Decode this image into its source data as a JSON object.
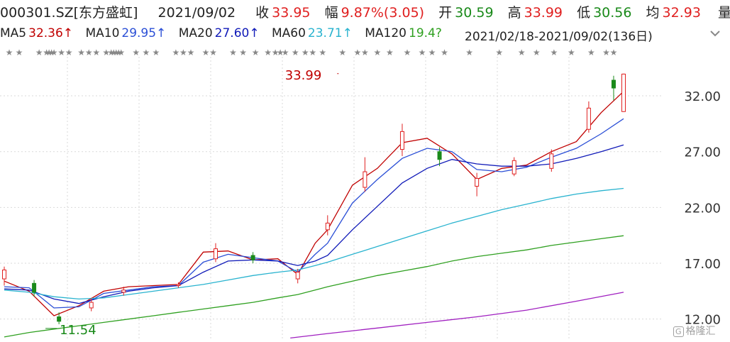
{
  "header": {
    "code": "000301.SZ[东方盛虹]",
    "date": "2021/09/02",
    "close_label": "收",
    "close": "33.95",
    "change_label": "幅",
    "change": "9.87%(3.05)",
    "open_label": "开",
    "open": "30.59",
    "high_label": "高",
    "high": "33.99",
    "low_label": "低",
    "low": "30.56",
    "avg_label": "均",
    "avg": "32.93",
    "volume_label": "量"
  },
  "ma_legend": [
    {
      "label": "MA5",
      "value": "32.36↑",
      "color": "#c00000"
    },
    {
      "label": "MA10",
      "value": "29.95↑",
      "color": "#2b4fd6"
    },
    {
      "label": "MA20",
      "value": "27.60↑",
      "color": "#101ab8"
    },
    {
      "label": "MA60",
      "value": "23.71↑",
      "color": "#29b3cf"
    },
    {
      "label": "MA120",
      "value": "19.4?",
      "color": "#2fa020"
    }
  ],
  "range_label": "2021/02/18-2021/09/02(136日)",
  "watermark": "格隆汇",
  "colors": {
    "up": "#e02020",
    "down": "#1a8a1a",
    "grid": "#d9d9d9",
    "axis_text": "#333333"
  },
  "chart_data": {
    "type": "candlestick",
    "title": "000301.SZ[东方盛虹]",
    "x_range": [
      "2021/02/18",
      "2021/09/02"
    ],
    "num_days": 136,
    "y_ticks": [
      12.0,
      17.0,
      22.0,
      27.0,
      32.0
    ],
    "ylim": [
      10.2,
      35.5
    ],
    "grid": true,
    "annotations": [
      {
        "text": "33.99",
        "type": "high",
        "day": 135,
        "price": 33.99
      },
      {
        "text": "11.54",
        "type": "low",
        "day": 20,
        "price": 11.54
      }
    ],
    "series": [
      {
        "name": "MA5",
        "color": "#c00000",
        "points": [
          [
            0,
            15.4
          ],
          [
            10,
            14.5
          ],
          [
            20,
            12.3
          ],
          [
            30,
            13.2
          ],
          [
            40,
            14.5
          ],
          [
            50,
            14.9
          ],
          [
            60,
            15.0
          ],
          [
            70,
            15.1
          ],
          [
            80,
            18.0
          ],
          [
            90,
            18.1
          ],
          [
            100,
            17.3
          ],
          [
            110,
            17.4
          ],
          [
            118,
            16.0
          ],
          [
            125,
            18.8
          ],
          [
            130,
            20.0
          ],
          [
            140,
            24.0
          ],
          [
            150,
            25.5
          ],
          [
            160,
            27.8
          ],
          [
            170,
            28.2
          ],
          [
            180,
            26.8
          ],
          [
            190,
            24.5
          ],
          [
            200,
            25.5
          ],
          [
            210,
            25.8
          ],
          [
            220,
            27.0
          ],
          [
            230,
            27.9
          ],
          [
            240,
            30.5
          ],
          [
            249,
            32.4
          ]
        ]
      },
      {
        "name": "MA10",
        "color": "#2b4fd6",
        "points": [
          [
            0,
            14.9
          ],
          [
            10,
            14.8
          ],
          [
            20,
            13.0
          ],
          [
            30,
            13.1
          ],
          [
            40,
            14.3
          ],
          [
            50,
            14.6
          ],
          [
            60,
            14.9
          ],
          [
            70,
            15.0
          ],
          [
            80,
            17.1
          ],
          [
            90,
            17.8
          ],
          [
            100,
            17.5
          ],
          [
            110,
            17.2
          ],
          [
            118,
            16.2
          ],
          [
            125,
            17.8
          ],
          [
            130,
            18.8
          ],
          [
            140,
            22.4
          ],
          [
            150,
            24.5
          ],
          [
            160,
            26.4
          ],
          [
            170,
            27.3
          ],
          [
            180,
            27.0
          ],
          [
            190,
            25.4
          ],
          [
            200,
            25.2
          ],
          [
            210,
            25.6
          ],
          [
            220,
            26.5
          ],
          [
            230,
            27.3
          ],
          [
            240,
            28.6
          ],
          [
            249,
            29.95
          ]
        ]
      },
      {
        "name": "MA20",
        "color": "#101ab8",
        "points": [
          [
            0,
            14.7
          ],
          [
            10,
            14.6
          ],
          [
            20,
            13.8
          ],
          [
            30,
            13.4
          ],
          [
            40,
            14.0
          ],
          [
            50,
            14.5
          ],
          [
            60,
            14.8
          ],
          [
            70,
            15.0
          ],
          [
            80,
            16.2
          ],
          [
            90,
            17.2
          ],
          [
            100,
            17.3
          ],
          [
            110,
            17.2
          ],
          [
            118,
            16.8
          ],
          [
            125,
            17.2
          ],
          [
            130,
            17.7
          ],
          [
            140,
            20.0
          ],
          [
            150,
            22.1
          ],
          [
            160,
            24.2
          ],
          [
            170,
            25.5
          ],
          [
            180,
            26.3
          ],
          [
            190,
            25.9
          ],
          [
            200,
            25.7
          ],
          [
            210,
            25.7
          ],
          [
            220,
            25.9
          ],
          [
            230,
            26.4
          ],
          [
            240,
            27.0
          ],
          [
            249,
            27.6
          ]
        ]
      },
      {
        "name": "MA60",
        "color": "#29b3cf",
        "points": [
          [
            0,
            14.6
          ],
          [
            10,
            14.4
          ],
          [
            20,
            14.0
          ],
          [
            30,
            13.8
          ],
          [
            40,
            13.9
          ],
          [
            50,
            14.2
          ],
          [
            60,
            14.5
          ],
          [
            70,
            14.8
          ],
          [
            80,
            15.1
          ],
          [
            90,
            15.5
          ],
          [
            100,
            15.9
          ],
          [
            110,
            16.2
          ],
          [
            118,
            16.4
          ],
          [
            125,
            16.8
          ],
          [
            130,
            17.1
          ],
          [
            140,
            17.8
          ],
          [
            150,
            18.5
          ],
          [
            160,
            19.2
          ],
          [
            170,
            19.9
          ],
          [
            180,
            20.6
          ],
          [
            190,
            21.2
          ],
          [
            200,
            21.8
          ],
          [
            210,
            22.3
          ],
          [
            220,
            22.8
          ],
          [
            230,
            23.2
          ],
          [
            240,
            23.5
          ],
          [
            249,
            23.71
          ]
        ]
      },
      {
        "name": "MA120",
        "color": "#2fa020",
        "points": [
          [
            0,
            10.4
          ],
          [
            10,
            10.8
          ],
          [
            20,
            11.1
          ],
          [
            30,
            11.4
          ],
          [
            40,
            11.7
          ],
          [
            50,
            12.0
          ],
          [
            60,
            12.3
          ],
          [
            70,
            12.6
          ],
          [
            80,
            12.9
          ],
          [
            90,
            13.2
          ],
          [
            100,
            13.5
          ],
          [
            110,
            13.9
          ],
          [
            118,
            14.2
          ],
          [
            125,
            14.6
          ],
          [
            130,
            14.9
          ],
          [
            140,
            15.4
          ],
          [
            150,
            15.9
          ],
          [
            160,
            16.3
          ],
          [
            170,
            16.7
          ],
          [
            180,
            17.2
          ],
          [
            190,
            17.6
          ],
          [
            200,
            17.9
          ],
          [
            210,
            18.2
          ],
          [
            220,
            18.6
          ],
          [
            230,
            18.9
          ],
          [
            240,
            19.2
          ],
          [
            249,
            19.47
          ]
        ]
      },
      {
        "name": "MA250",
        "color": "#a020c0",
        "points": [
          [
            115,
            10.3
          ],
          [
            130,
            10.7
          ],
          [
            150,
            11.2
          ],
          [
            170,
            11.7
          ],
          [
            190,
            12.2
          ],
          [
            210,
            12.8
          ],
          [
            230,
            13.6
          ],
          [
            249,
            14.4
          ]
        ]
      }
    ],
    "candles": [
      {
        "day": 0,
        "open": 15.6,
        "close": 16.4,
        "high": 16.7,
        "low": 15.0
      },
      {
        "day": 12,
        "open": 15.2,
        "close": 14.4,
        "high": 15.5,
        "low": 14.0
      },
      {
        "day": 22,
        "open": 12.2,
        "close": 11.8,
        "high": 12.6,
        "low": 11.54
      },
      {
        "day": 35,
        "open": 13.0,
        "close": 13.5,
        "high": 13.9,
        "low": 12.7
      },
      {
        "day": 48,
        "open": 14.4,
        "close": 14.6,
        "high": 14.9,
        "low": 14.1
      },
      {
        "day": 70,
        "open": 15.0,
        "close": 15.1,
        "high": 15.3,
        "low": 14.8
      },
      {
        "day": 85,
        "open": 17.4,
        "close": 18.3,
        "high": 18.8,
        "low": 17.1
      },
      {
        "day": 100,
        "open": 17.7,
        "close": 17.3,
        "high": 18.0,
        "low": 17.0
      },
      {
        "day": 118,
        "open": 15.6,
        "close": 16.2,
        "high": 16.5,
        "low": 15.2
      },
      {
        "day": 130,
        "open": 20.0,
        "close": 20.6,
        "high": 21.3,
        "low": 19.5
      },
      {
        "day": 145,
        "open": 23.8,
        "close": 25.2,
        "high": 26.5,
        "low": 23.4
      },
      {
        "day": 160,
        "open": 27.2,
        "close": 28.8,
        "high": 29.5,
        "low": 26.6
      },
      {
        "day": 175,
        "open": 27.0,
        "close": 26.3,
        "high": 27.4,
        "low": 25.7
      },
      {
        "day": 190,
        "open": 23.9,
        "close": 24.6,
        "high": 25.1,
        "low": 23.0
      },
      {
        "day": 205,
        "open": 25.0,
        "close": 26.2,
        "high": 26.5,
        "low": 24.8
      },
      {
        "day": 220,
        "open": 25.5,
        "close": 26.8,
        "high": 27.2,
        "low": 25.2
      },
      {
        "day": 235,
        "open": 29.0,
        "close": 30.9,
        "high": 31.5,
        "low": 28.7
      },
      {
        "day": 245,
        "open": 33.4,
        "close": 32.7,
        "high": 33.8,
        "low": 31.6
      },
      {
        "day": 249,
        "open": 30.59,
        "close": 33.95,
        "high": 33.99,
        "low": 30.56
      }
    ],
    "event_markers": [
      2,
      6,
      14,
      17,
      18,
      19,
      20,
      23,
      26,
      31,
      34,
      37,
      41,
      43,
      44,
      45,
      46,
      47,
      53,
      57,
      61,
      69,
      72,
      75,
      81,
      84,
      92,
      96,
      101,
      106,
      109,
      111,
      113,
      117,
      121,
      124,
      128,
      136,
      142,
      145,
      150,
      155,
      162,
      168,
      172,
      177,
      187,
      199,
      208,
      214,
      221,
      228,
      236,
      242,
      245
    ]
  }
}
